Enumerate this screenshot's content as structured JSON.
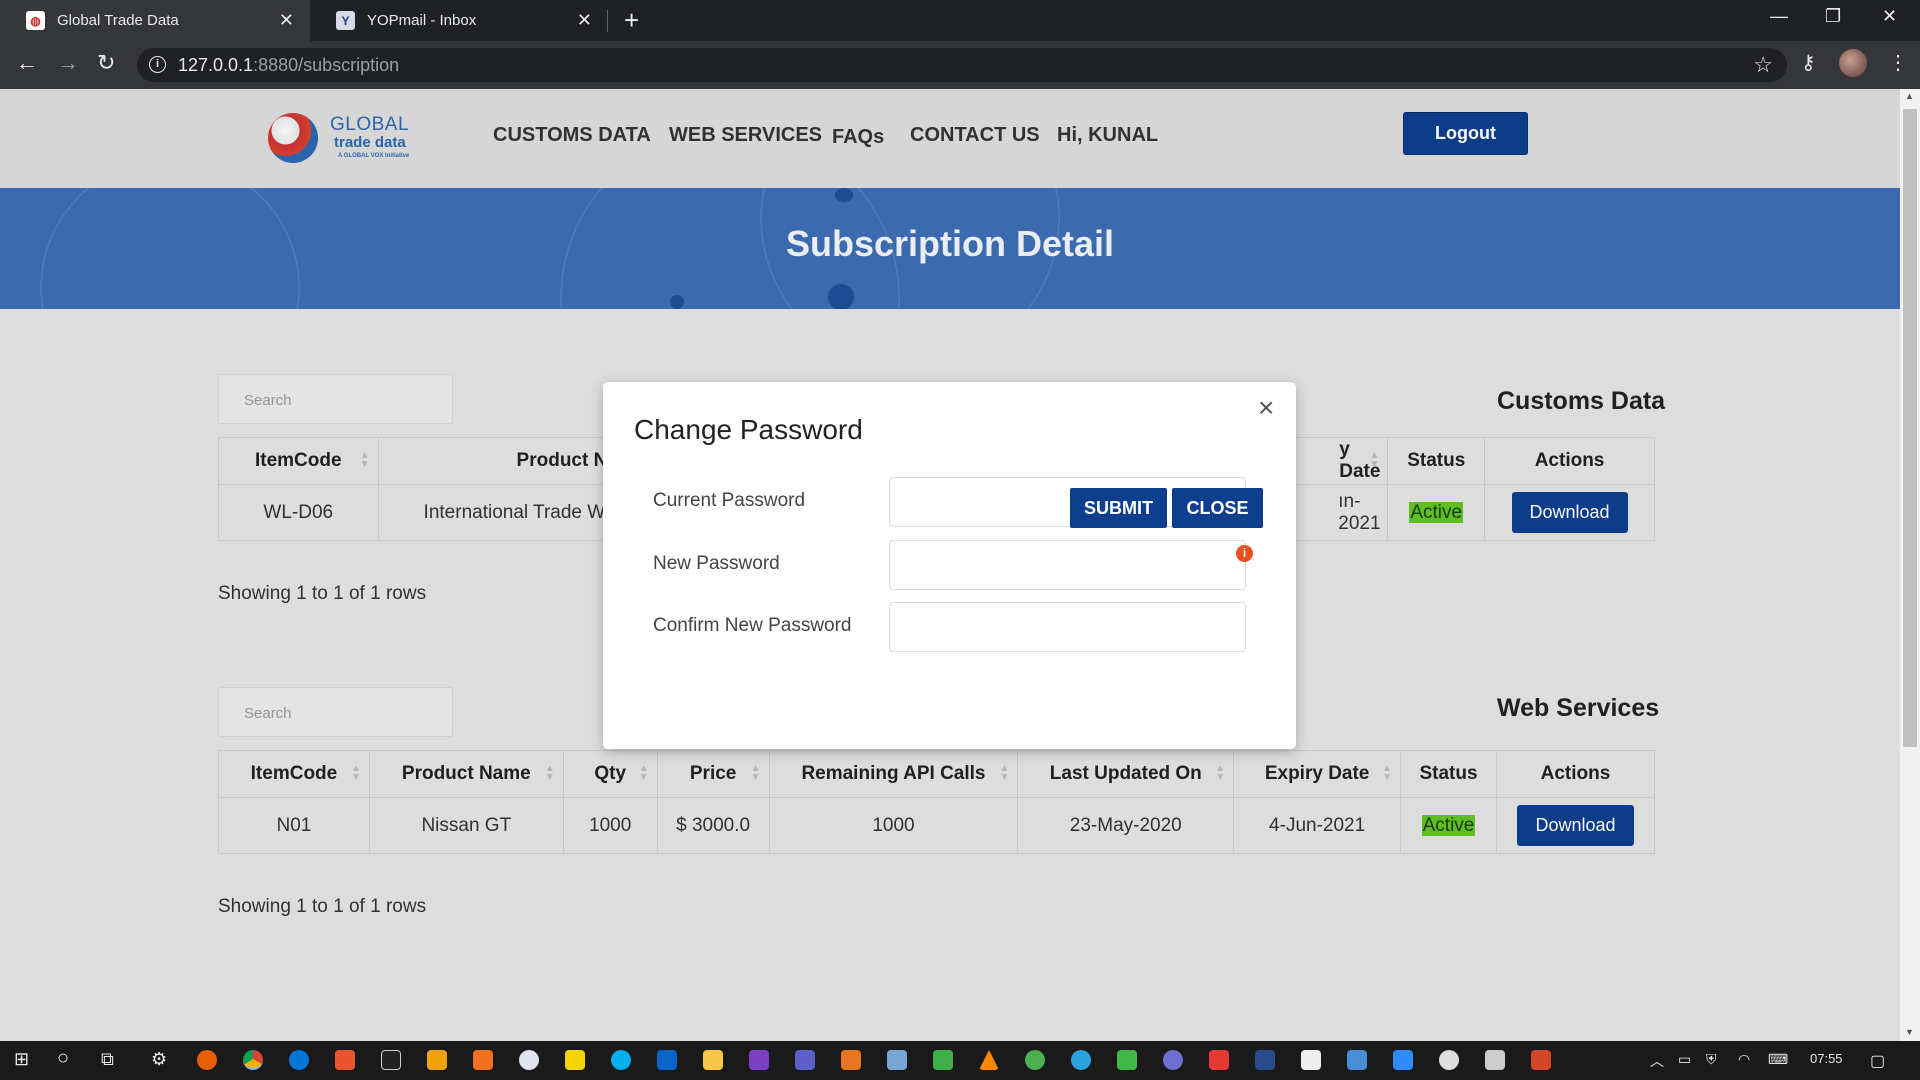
{
  "browser": {
    "tabs": [
      {
        "title": "Global Trade Data",
        "active": true
      },
      {
        "title": "YOPmail - Inbox",
        "active": false
      }
    ],
    "url_host": "127.0.0.1",
    "url_rest": ":8880/subscription"
  },
  "header": {
    "logo": {
      "line1": "GLOBAL",
      "line2": "trade data",
      "line3": "A GLOBAL VOX Initiative"
    },
    "nav": [
      "CUSTOMS DATA",
      "WEB SERVICES",
      "FAQs",
      "CONTACT US",
      "Hi, KUNAL"
    ],
    "logout_label": "Logout"
  },
  "banner": {
    "title": "Subscription Detail"
  },
  "customs": {
    "title": "Customs Data",
    "search_placeholder": "Search",
    "columns": [
      "ItemCode",
      "Product Na",
      "y Date",
      "Status",
      "Actions"
    ],
    "row": {
      "item_code": "WL-D06",
      "product": "International Trade Wa",
      "expiry": "ın-2021",
      "status": "Active",
      "action": "Download"
    },
    "rows_info": "Showing 1 to 1 of 1 rows"
  },
  "webservices": {
    "title": "Web Services",
    "search_placeholder": "Search",
    "columns": [
      "ItemCode",
      "Product Name",
      "Qty",
      "Price",
      "Remaining API Calls",
      "Last Updated On",
      "Expiry Date",
      "Status",
      "Actions"
    ],
    "row": {
      "item_code": "N01",
      "product": "Nissan GT",
      "qty": "1000",
      "price": "$ 3000.0",
      "remaining": "1000",
      "updated": "23-May-2020",
      "expiry": "4-Jun-2021",
      "status": "Active",
      "action": "Download"
    },
    "rows_info": "Showing 1 to 1 of 1 rows"
  },
  "modal": {
    "title": "Change Password",
    "close_glyph": "×",
    "fields": [
      {
        "label": "Current Password",
        "value": ""
      },
      {
        "label": "New Password",
        "value": ""
      },
      {
        "label": "Confirm New Password",
        "value": ""
      }
    ],
    "submit_label": "SUBMIT",
    "close_label": "CLOSE"
  },
  "taskbar": {
    "time": "07:55"
  },
  "colors": {
    "primary_button": "#0e3e8e",
    "banner": "#3d6fb4",
    "active_badge": "#62c524"
  }
}
